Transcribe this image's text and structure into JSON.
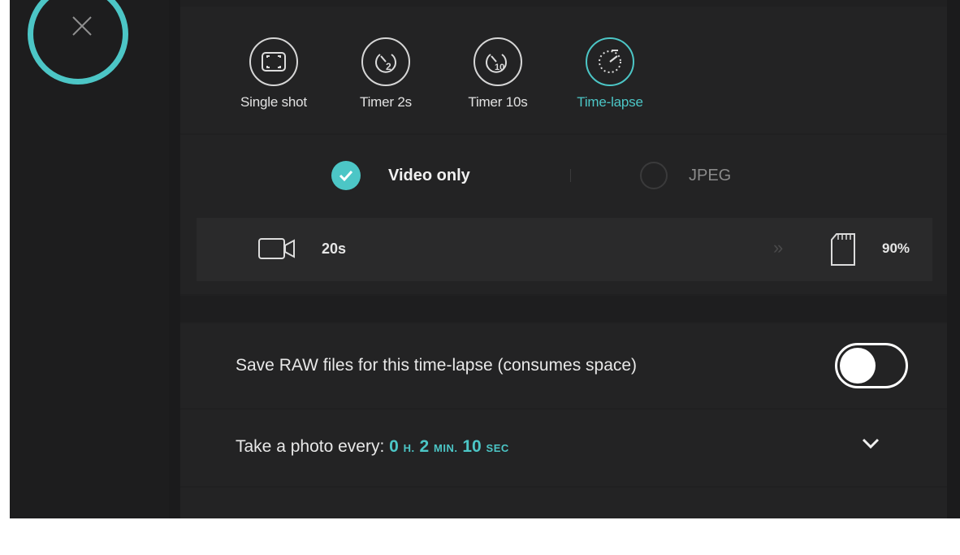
{
  "sidebar": {
    "close_icon": "close-icon"
  },
  "modes": [
    {
      "label": "Single shot",
      "icon": "single-shot-icon",
      "active": false
    },
    {
      "label": "Timer 2s",
      "icon": "timer-2s-icon",
      "active": false
    },
    {
      "label": "Timer 10s",
      "icon": "timer-10s-icon",
      "active": false
    },
    {
      "label": "Time-lapse",
      "icon": "time-lapse-icon",
      "active": true
    }
  ],
  "format": {
    "video_only_label": "Video only",
    "jpeg_label": "JPEG",
    "selected": "Video only"
  },
  "info": {
    "duration": "20s",
    "storage": "90%"
  },
  "raw": {
    "label": "Save RAW files for this time-lapse (consumes space)",
    "enabled": false
  },
  "interval": {
    "label": "Take a photo every:",
    "hours": "0",
    "hours_unit": "H.",
    "minutes": "2",
    "minutes_unit": "MIN.",
    "seconds": "10",
    "seconds_unit": "SEC"
  },
  "colors": {
    "accent": "#4cc6c6",
    "background": "#1b1b1c"
  }
}
